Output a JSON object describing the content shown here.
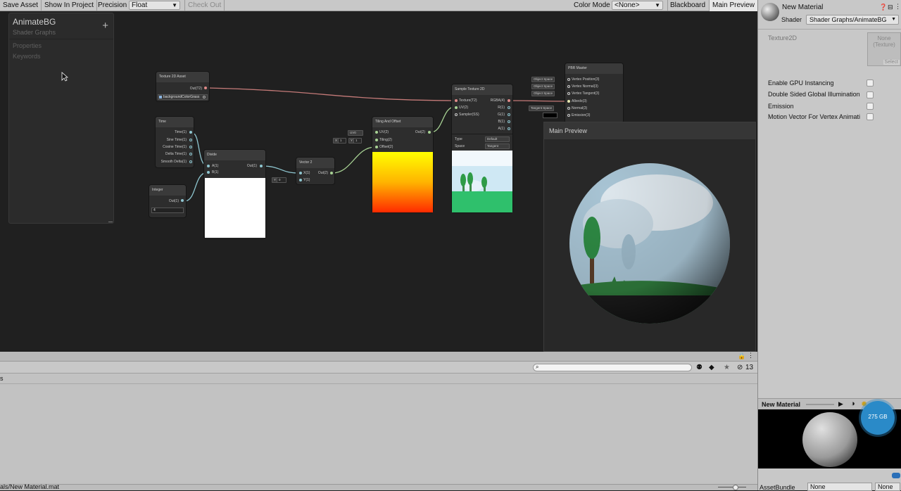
{
  "toolbar": {
    "save_asset": "Save Asset",
    "show_in_project": "Show In Project",
    "precision_label": "Precision",
    "precision_value": "Float",
    "check_out": "Check Out",
    "color_mode_label": "Color Mode",
    "color_mode_value": "<None>",
    "blackboard": "Blackboard",
    "main_preview": "Main Preview"
  },
  "blackboard": {
    "title": "AnimateBG",
    "subtitle": "Shader Graphs",
    "add": "+",
    "sections": [
      "Properties",
      "Keywords"
    ]
  },
  "nodes": {
    "tex_asset": {
      "title": "Texture 2D Asset",
      "out": "Out(T2)",
      "field": "backgroundColorGrass"
    },
    "time": {
      "title": "Time",
      "ports": [
        "Time(1)",
        "Sine Time(1)",
        "Cosine Time(1)",
        "Delta Time(1)",
        "Smooth Delta(1)"
      ]
    },
    "integer": {
      "title": "Integer",
      "out": "Out(1)",
      "value": "4"
    },
    "divide": {
      "title": "Divide",
      "a": "A(1)",
      "b": "B(1)",
      "out": "Out(1)"
    },
    "vector2": {
      "title": "Vector 2",
      "x": "X(1)",
      "y": "Y(1)",
      "out": "Out(2)",
      "y_label": "Y",
      "y_value": "0"
    },
    "tiling": {
      "title": "Tiling And Offset",
      "uv": "UV(2)",
      "tiling": "Tiling(2)",
      "offset": "Offset(2)",
      "out": "Out(2)",
      "uv_chip": "UV0",
      "x_label": "X",
      "x_value": "1",
      "y_label": "Y",
      "y_value": "1"
    },
    "sample": {
      "title": "Sample Texture 2D",
      "texture": "Texture(T2)",
      "uv": "UV(2)",
      "sampler": "Sampler(SS)",
      "outs": [
        "RGBA(4)",
        "R(1)",
        "G(1)",
        "B(1)",
        "A(1)"
      ],
      "type_label": "Type",
      "type_value": "Default",
      "space_label": "Space",
      "space_value": "Tangent"
    },
    "pbr": {
      "title": "PBR Master",
      "ports": [
        "Vertex Position(3)",
        "Vertex Normal(3)",
        "Vertex Tangent(3)",
        "Albedo(3)",
        "Normal(3)",
        "Emission(3)"
      ],
      "chips": [
        "Object Space",
        "Object Space",
        "Object Space",
        "Tangent Space"
      ]
    }
  },
  "main_preview": {
    "title": "Main Preview"
  },
  "inspector": {
    "name": "New Material",
    "shader_label": "Shader",
    "shader_value": "Shader Graphs/AnimateBG",
    "texture_label": "Texture2D",
    "texture_none": "None",
    "texture_type": "(Texture)",
    "select": "Select",
    "options": [
      "Enable GPU Instancing",
      "Double Sided Global Illumination",
      "Emission",
      "Motion Vector For Vertex Animati"
    ],
    "preview_title": "New Material",
    "badge": "275 GB",
    "asset_bundle_label": "AssetBundle",
    "asset_bundle_value": "None",
    "asset_bundle_variant": "None"
  },
  "bottom": {
    "count": "13",
    "path": "als/New Material.mat",
    "row_mark": "s"
  }
}
